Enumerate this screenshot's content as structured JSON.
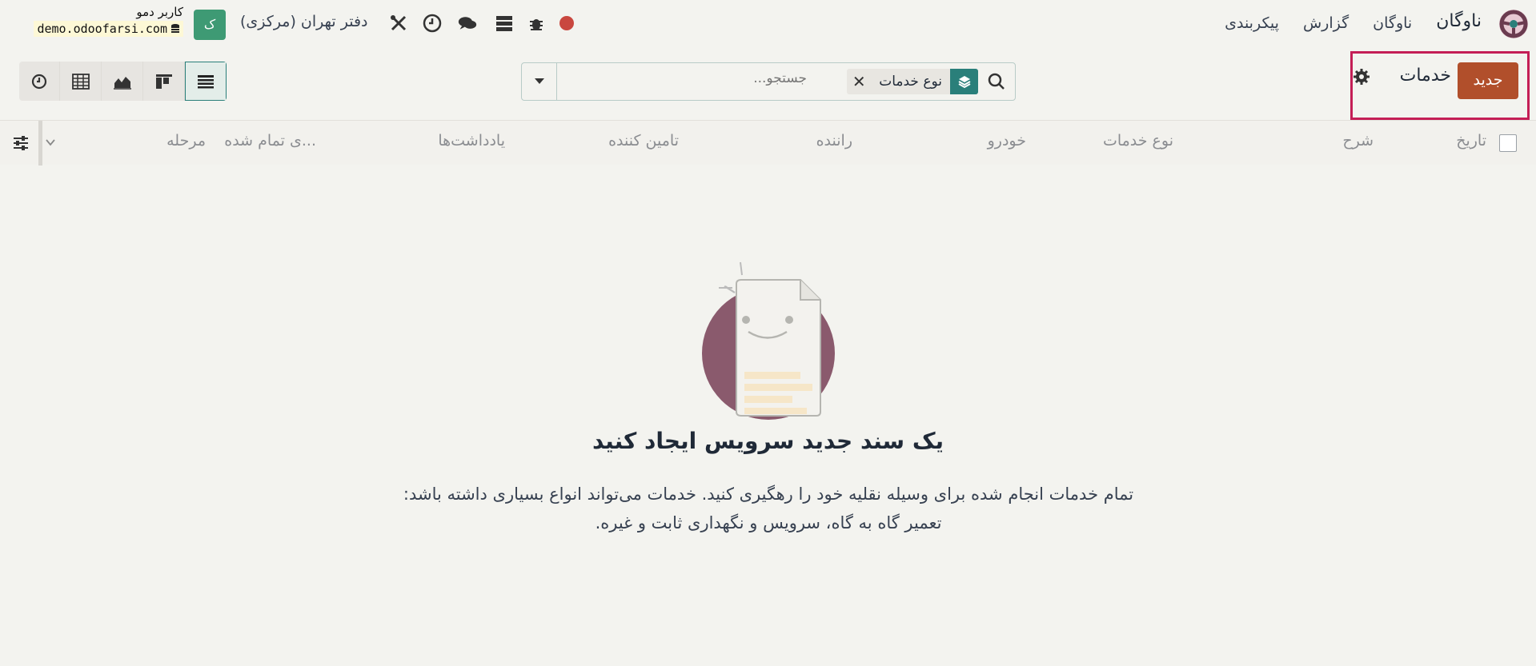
{
  "topbar": {
    "app_name": "ناوگان",
    "menu": [
      "ناوگان",
      "گزارش",
      "پیکربندی"
    ],
    "company": "دفتر تهران (مرکزی)",
    "user_name": "کاربر دمو",
    "database": "demo.odoofarsi.com",
    "avatar_letter": "ک",
    "icons": [
      "record-icon",
      "bug-icon",
      "database-icon",
      "chat-icon",
      "clock-icon",
      "tools-icon"
    ]
  },
  "control": {
    "new_label": "جدید",
    "breadcrumb": "خدمات",
    "search": {
      "facet_label": "نوع خدمات",
      "placeholder": "جستجو..."
    },
    "views": [
      "activity",
      "pivot",
      "graph",
      "kanban",
      "list"
    ],
    "active_view": "list"
  },
  "table": {
    "headers": {
      "date": "تاریخ",
      "description": "شرح",
      "service_type": "نوع خدمات",
      "vehicle": "خودرو",
      "driver": "راننده",
      "vendor": "تامین کننده",
      "notes": "یادداشت‌ها",
      "cost": "...ی تمام شده",
      "stage": "مرحله"
    }
  },
  "empty_state": {
    "title": "یک سند جدید سرویس ایجاد کنید",
    "description": "تمام خدمات انجام شده برای وسیله نقلیه خود را رهگیری کنید. خدمات می‌تواند انواع بسیاری داشته باشد: تعمیر گاه به گاه، سرویس و نگهداری ثابت و غیره."
  },
  "colors": {
    "primary": "#b14f2b",
    "accent": "#2a7f7a",
    "highlight": "#c41e56",
    "avatar": "#3e9a74"
  }
}
